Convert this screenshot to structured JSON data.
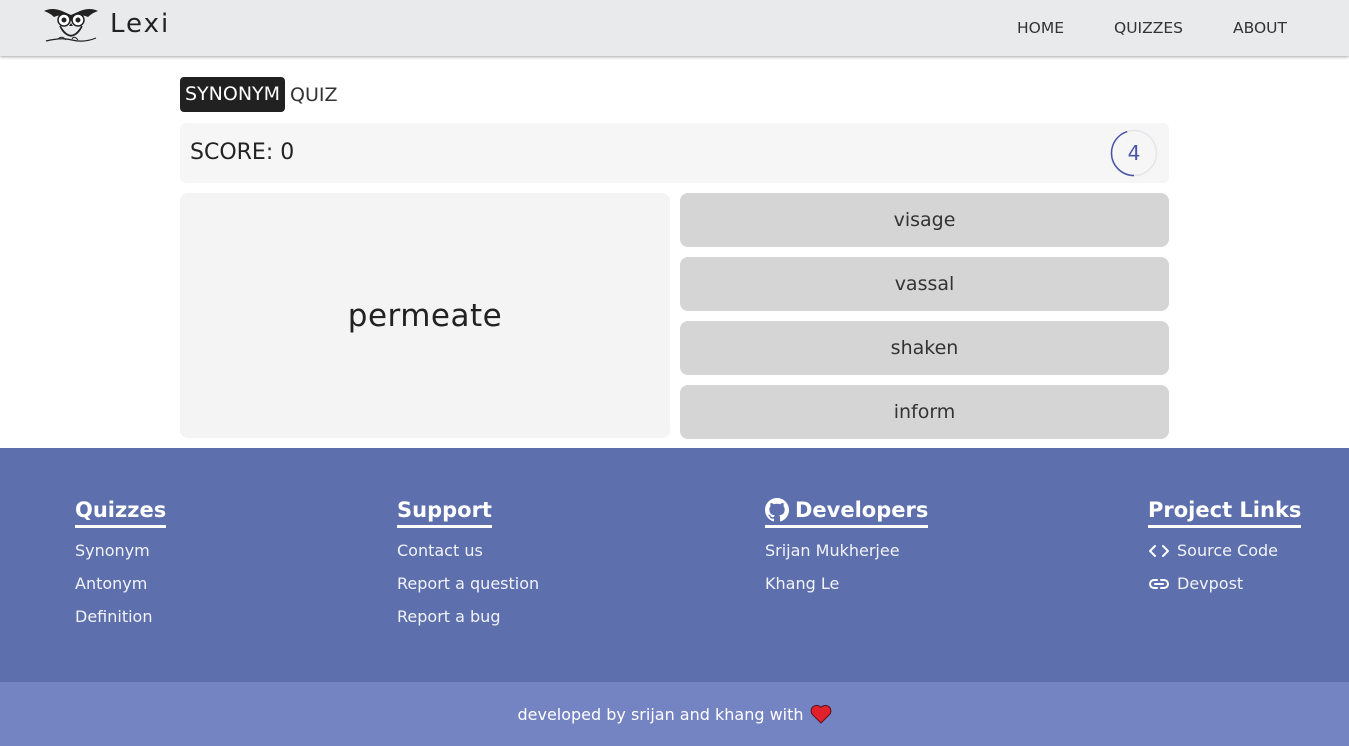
{
  "app": {
    "name": "Lexi"
  },
  "nav": {
    "items": [
      "HOME",
      "QUIZZES",
      "ABOUT"
    ]
  },
  "quiz": {
    "type_label": "SYNONYM",
    "title_suffix": "QUIZ",
    "score_label": "SCORE: 0",
    "timer_value": "4",
    "timer_remaining_fraction": 0.45,
    "prompt_word": "permeate",
    "options": [
      "visage",
      "vassal",
      "shaken",
      "inform"
    ]
  },
  "footer": {
    "columns": [
      {
        "heading": "Quizzes",
        "links": [
          "Synonym",
          "Antonym",
          "Definition"
        ]
      },
      {
        "heading": "Support",
        "links": [
          "Contact us",
          "Report a question",
          "Report a bug"
        ]
      },
      {
        "heading": "Developers",
        "icon": "github-icon",
        "links": [
          "Srijan Mukherjee",
          "Khang Le"
        ]
      },
      {
        "heading": "Project Links",
        "links": [
          "Source Code",
          "Devpost"
        ],
        "link_icons": [
          "code-icon",
          "link-icon"
        ]
      }
    ],
    "credit": "developed by srijan and khang with"
  },
  "colors": {
    "navbar_bg": "#e9eaec",
    "footer_bg": "#5d6fac",
    "bottom_bar_bg": "#7483c2",
    "option_bg": "#d5d5d6",
    "accent": "#4a55a6",
    "heart": "#e0202a"
  }
}
